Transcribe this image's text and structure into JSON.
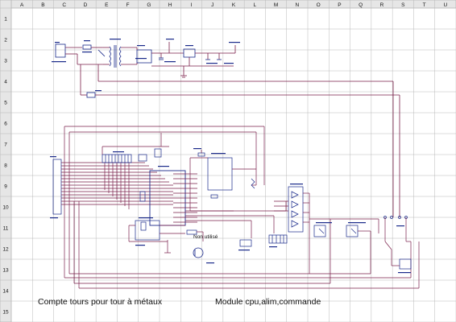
{
  "sheet": {
    "columns": [
      "A",
      "B",
      "C",
      "D",
      "E",
      "F",
      "G",
      "H",
      "I",
      "J",
      "K",
      "L",
      "M",
      "N",
      "O",
      "P",
      "Q",
      "R",
      "S",
      "T",
      "U"
    ],
    "rows": [
      "1",
      "2",
      "3",
      "4",
      "5",
      "6",
      "7",
      "8",
      "9",
      "10",
      "11",
      "12",
      "13",
      "14",
      "15"
    ]
  },
  "schematic": {
    "not_used_label": "Non utilisé"
  },
  "captions": {
    "left": "Compte tours pour tour à métaux",
    "right": "Module cpu,alim,commande"
  },
  "colors": {
    "wire": "#7a1f4a",
    "part": "#1a2a8a",
    "grid": "#b8b8b8",
    "header": "#e6e6e6",
    "text": "#111111"
  }
}
